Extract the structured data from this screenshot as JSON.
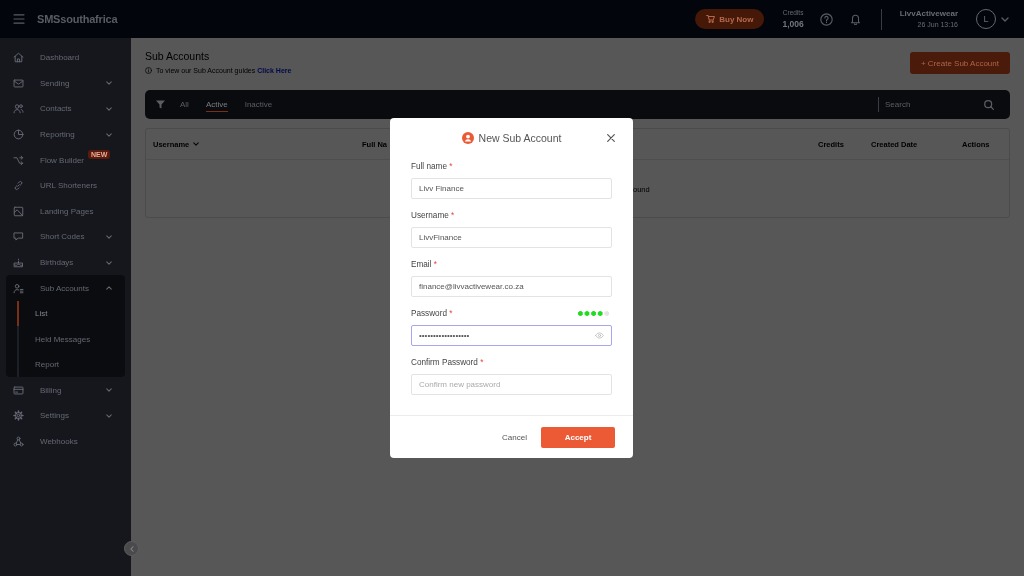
{
  "top_bar": {
    "logo": "SMSsouthafrica",
    "buy_button": "Buy Now",
    "credits_label": "Credits",
    "credits_value": "1,006",
    "account_name": "LivvActivewear",
    "account_date": "26 Jun 13:16",
    "avatar_letter": "L"
  },
  "sidebar": {
    "items": [
      {
        "label": "Dashboard",
        "submenu": false,
        "selected": false
      },
      {
        "label": "Sending",
        "submenu": true,
        "expanded": false,
        "selected": false
      },
      {
        "label": "Contacts",
        "submenu": true,
        "expanded": false,
        "selected": false
      },
      {
        "label": "Reporting",
        "submenu": true,
        "expanded": false,
        "selected": false
      },
      {
        "label": "Flow Builder",
        "badge": "NEW",
        "submenu": false,
        "selected": false
      },
      {
        "label": "URL Shorteners",
        "submenu": false,
        "selected": false
      },
      {
        "label": "Landing Pages",
        "submenu": false,
        "selected": false
      },
      {
        "label": "Short Codes",
        "submenu": true,
        "expanded": false,
        "selected": false
      },
      {
        "label": "Birthdays",
        "submenu": true,
        "expanded": false,
        "selected": false
      },
      {
        "label": "Sub Accounts",
        "submenu": true,
        "expanded": true,
        "selected": false,
        "children": [
          {
            "label": "List",
            "selected": true
          },
          {
            "label": "Held Messages",
            "selected": false
          },
          {
            "label": "Report",
            "selected": false
          }
        ]
      },
      {
        "label": "Billing",
        "submenu": true,
        "expanded": false,
        "selected": false
      },
      {
        "label": "Settings",
        "submenu": true,
        "expanded": false,
        "selected": false
      },
      {
        "label": "Webhooks",
        "submenu": false,
        "selected": false
      }
    ]
  },
  "page": {
    "title": "Sub Accounts",
    "info": {
      "text": "To view our Sub Account guides",
      "link": "Click Here"
    },
    "create_button": "+ Create Sub Account",
    "filter_bar": {
      "tabs": [
        {
          "label": "All",
          "selected": false
        },
        {
          "label": "Active",
          "selected": true
        },
        {
          "label": "Inactive",
          "selected": false
        }
      ],
      "search": {
        "placeholder": "Search"
      }
    },
    "table": {
      "columns": [
        {
          "label": "Username",
          "sortable": true
        },
        {
          "label": "Full Na",
          "sortable": false
        },
        {
          "label": "Credits",
          "sortable": false
        },
        {
          "label": "Created Date",
          "sortable": false
        },
        {
          "label": "Actions",
          "sortable": false
        }
      ],
      "empty_message": "ound"
    }
  },
  "modal": {
    "title": "New Sub Account",
    "fields": [
      {
        "label": "Full name",
        "required_mark": "*",
        "kind": "plain",
        "value": "Livv Finance",
        "focused": false
      },
      {
        "label": "Username",
        "required_mark": "*",
        "kind": "plain",
        "value": "LivvFinance",
        "focused": false
      },
      {
        "label": "Email",
        "required_mark": "*",
        "kind": "plain",
        "value": "finance@livvactivewear.co.za",
        "focused": false
      },
      {
        "label": "Password",
        "required_mark": "*",
        "kind": "password",
        "value": "••••••••••••••••••",
        "level": 0.8,
        "focused": true
      },
      {
        "label": "Confirm Password",
        "required_mark": "*",
        "kind": "plain",
        "placeholder": "Confirm new password",
        "focused": false
      }
    ],
    "cancel_button": "Cancel",
    "accept_button": "Accept"
  }
}
